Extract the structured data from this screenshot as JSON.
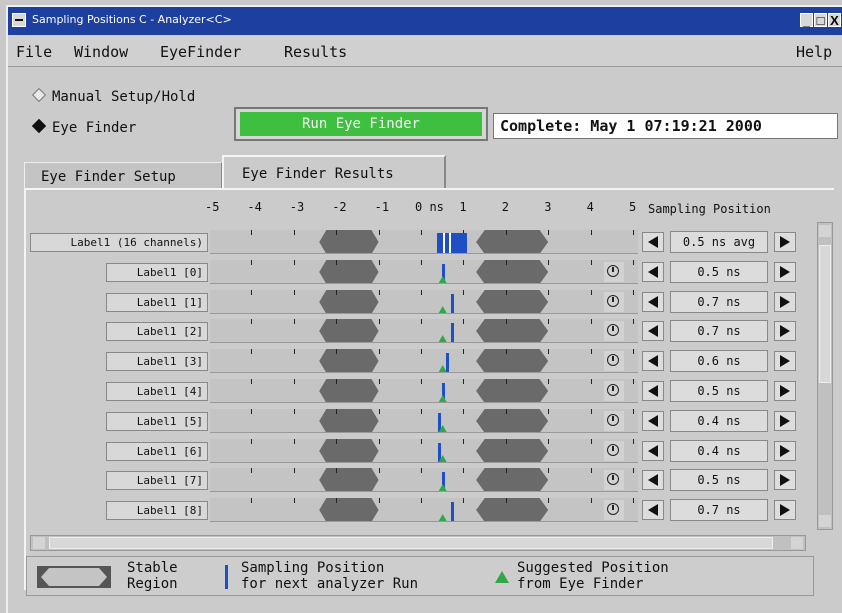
{
  "window": {
    "title": "Sampling Positions C - Analyzer<C>",
    "controls": [
      "_",
      "□",
      "X"
    ]
  },
  "menu": {
    "items": [
      "File",
      "Window",
      "EyeFinder",
      "Results"
    ],
    "help": "Help"
  },
  "mode": {
    "options": [
      {
        "label": "Manual Setup/Hold",
        "selected": false
      },
      {
        "label": "Eye Finder",
        "selected": true
      }
    ],
    "run_button": "Run Eye Finder",
    "status": "Complete: May  1 07:19:21 2000"
  },
  "tabs": [
    {
      "label": "Eye Finder Setup",
      "active": false
    },
    {
      "label": "Eye Finder Results",
      "active": true
    }
  ],
  "scale": {
    "ticks": [
      "-5",
      "-4",
      "-3",
      "-2",
      "-1",
      "0 ns",
      "1",
      "2",
      "3",
      "4",
      "5"
    ],
    "column_header": "Sampling Position"
  },
  "rows": [
    {
      "label": "Label1 (16 channels)",
      "value": "0.5 ns avg",
      "position_ns": 0.5,
      "summary": true
    },
    {
      "label": "Label1  [0]",
      "value": "0.5 ns",
      "position_ns": 0.5
    },
    {
      "label": "Label1  [1]",
      "value": "0.7 ns",
      "position_ns": 0.7
    },
    {
      "label": "Label1  [2]",
      "value": "0.7 ns",
      "position_ns": 0.7
    },
    {
      "label": "Label1  [3]",
      "value": "0.6 ns",
      "position_ns": 0.6
    },
    {
      "label": "Label1  [4]",
      "value": "0.5 ns",
      "position_ns": 0.5
    },
    {
      "label": "Label1  [5]",
      "value": "0.4 ns",
      "position_ns": 0.4
    },
    {
      "label": "Label1  [6]",
      "value": "0.4 ns",
      "position_ns": 0.4
    },
    {
      "label": "Label1  [7]",
      "value": "0.5 ns",
      "position_ns": 0.5
    },
    {
      "label": "Label1  [8]",
      "value": "0.7 ns",
      "position_ns": 0.7
    }
  ],
  "legend": {
    "stable": "Stable\nRegion",
    "sampling": "Sampling Position\nfor next analyzer Run",
    "suggested": "Suggested Position\nfrom Eye Finder"
  },
  "colors": {
    "title_bar": "#1c3fa0",
    "run_button": "#3fbf3f",
    "stable_region": "#c4c4c4",
    "transition_region": "#6a6a6a",
    "sampling_marker": "#1f4fc4",
    "suggested_marker": "#2fa84a"
  }
}
